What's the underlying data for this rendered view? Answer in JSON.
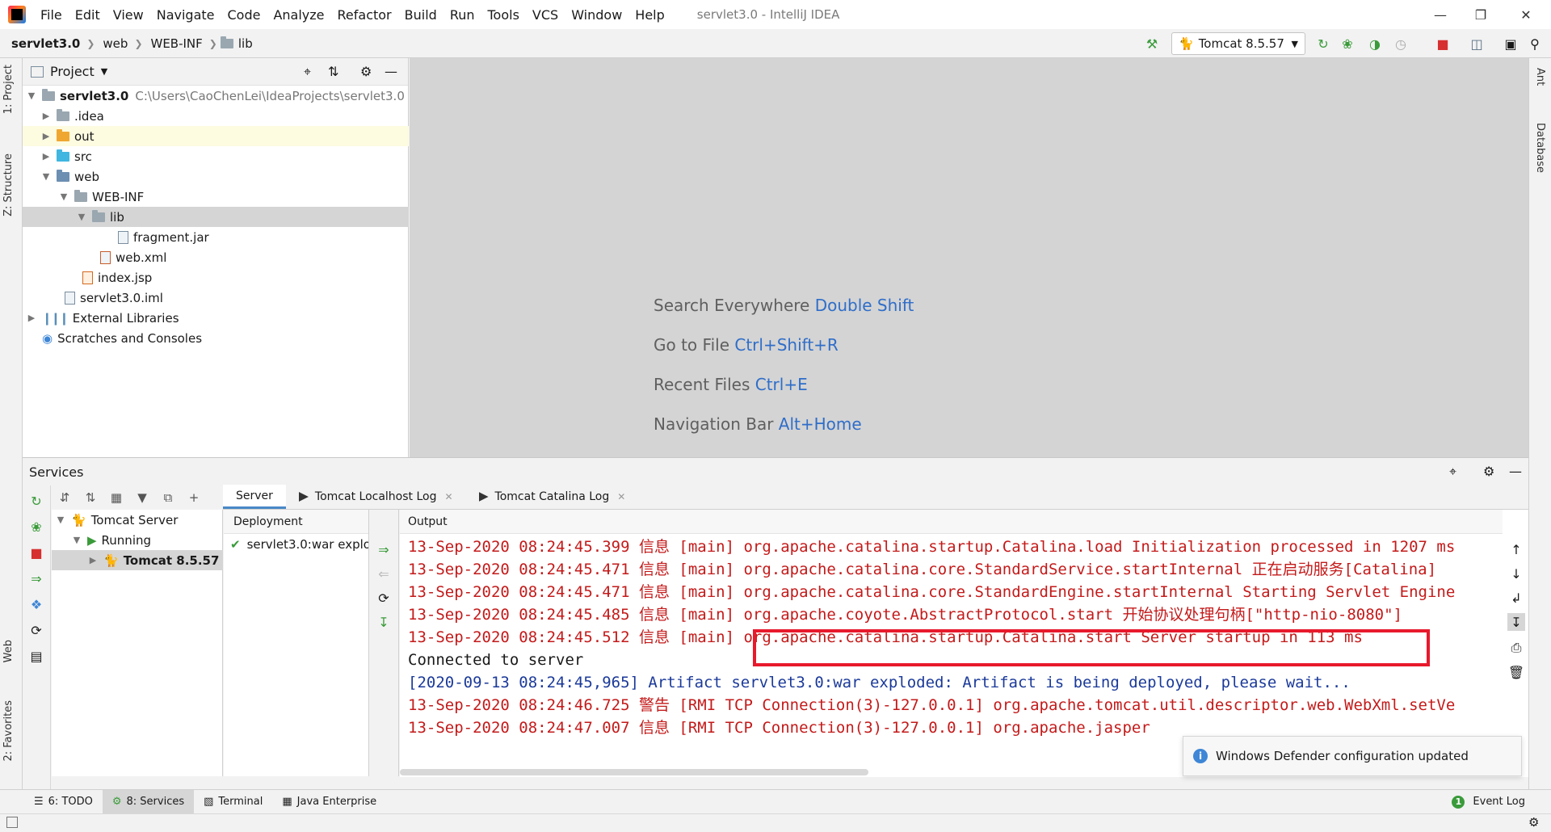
{
  "menu": {
    "items": [
      "File",
      "Edit",
      "View",
      "Navigate",
      "Code",
      "Analyze",
      "Refactor",
      "Build",
      "Run",
      "Tools",
      "VCS",
      "Window",
      "Help"
    ],
    "window_title": "servlet3.0 - IntelliJ IDEA"
  },
  "breadcrumb": [
    "servlet3.0",
    "web",
    "WEB-INF",
    "lib"
  ],
  "run_config": "Tomcat 8.5.57",
  "left_strip": {
    "project": "1: Project",
    "structure": "Z: Structure",
    "web": "Web",
    "favorites": "2: Favorites"
  },
  "right_strip": {
    "ant": "Ant",
    "database": "Database"
  },
  "project_panel": {
    "title": "Project",
    "tree": [
      {
        "name": "servlet3.0",
        "path": "C:\\Users\\CaoChenLei\\IdeaProjects\\servlet3.0"
      },
      {
        "name": ".idea"
      },
      {
        "name": "out"
      },
      {
        "name": "src"
      },
      {
        "name": "web"
      },
      {
        "name": "WEB-INF"
      },
      {
        "name": "lib"
      },
      {
        "name": "fragment.jar"
      },
      {
        "name": "web.xml"
      },
      {
        "name": "index.jsp"
      },
      {
        "name": "servlet3.0.iml"
      },
      {
        "name": "External Libraries"
      },
      {
        "name": "Scratches and Consoles"
      }
    ]
  },
  "editor_hints": [
    {
      "label": "Search Everywhere",
      "key": "Double Shift"
    },
    {
      "label": "Go to File",
      "key": "Ctrl+Shift+R"
    },
    {
      "label": "Recent Files",
      "key": "Ctrl+E"
    },
    {
      "label": "Navigation Bar",
      "key": "Alt+Home"
    }
  ],
  "services": {
    "title": "Services",
    "tree": [
      "Tomcat Server",
      "Running",
      "Tomcat 8.5.57"
    ],
    "tabs": [
      "Server",
      "Tomcat Localhost Log",
      "Tomcat Catalina Log"
    ],
    "deployment_header": "Deployment",
    "deployment_item": "servlet3.0:war explo",
    "output_header": "Output",
    "log": [
      "13-Sep-2020 08:24:45.399 信息 [main] org.apache.catalina.startup.Catalina.load Initialization processed in 1207 ms",
      "13-Sep-2020 08:24:45.471 信息 [main] org.apache.catalina.core.StandardService.startInternal 正在启动服务[Catalina]",
      "13-Sep-2020 08:24:45.471 信息 [main] org.apache.catalina.core.StandardEngine.startInternal Starting Servlet Engine",
      "13-Sep-2020 08:24:45.485 信息 [main] org.apache.coyote.AbstractProtocol.start 开始协议处理句柄[\"http-nio-8080\"]",
      "13-Sep-2020 08:24:45.512 信息 [main] org.apache.catalina.startup.Catalina.start Server startup in 113 ms",
      "Connected to server",
      "[2020-09-13 08:24:45,965] Artifact servlet3.0:war exploded: Artifact is being deployed, please wait...",
      "13-Sep-2020 08:24:46.725 警告 [RMI TCP Connection(3)-127.0.0.1] org.apache.tomcat.util.descriptor.web.WebXml.setVe",
      "13-Sep-2020 08:24:47.007 信息 [RMI TCP Connection(3)-127.0.0.1] org.apache.jasper"
    ]
  },
  "notification": "Windows Defender configuration updated",
  "bottom_tabs": [
    "6: TODO",
    "8: Services",
    "Terminal",
    "Java Enterprise"
  ],
  "event_log": "Event Log",
  "colors": {
    "accent": "#3e86d6",
    "highlight_box": "#e8192c"
  }
}
